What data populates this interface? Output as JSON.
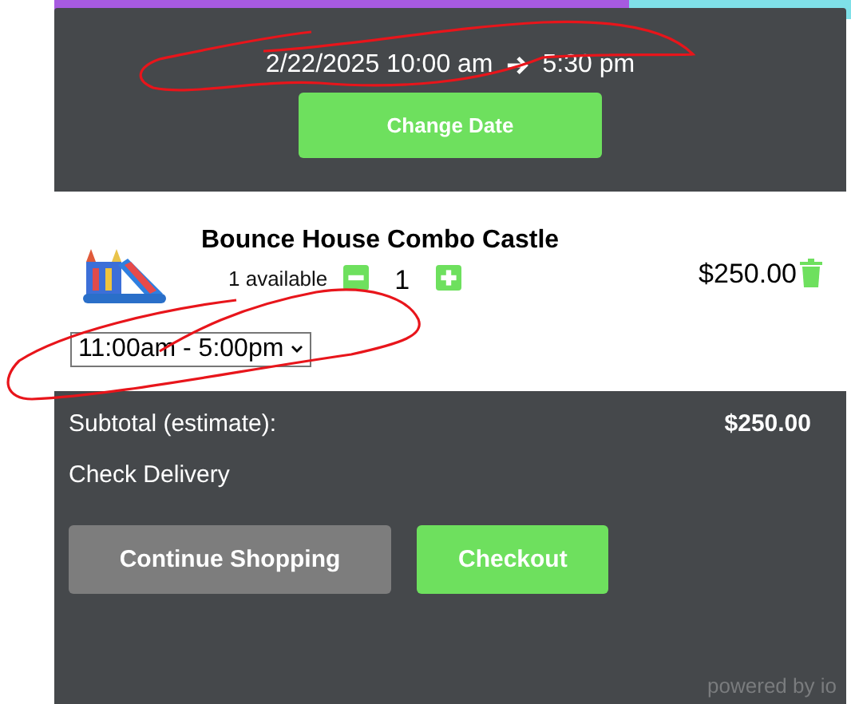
{
  "booking": {
    "start": "2/22/2025 10:00 am",
    "end": "5:30 pm",
    "change_button": "Change Date"
  },
  "cart_item": {
    "kind": "picture",
    "name": "Bounce House Combo Castle",
    "availability": "1 available",
    "quantity": "1",
    "price": "$250.00",
    "time_slot": "11:00am - 5:00pm"
  },
  "summary": {
    "subtotal_label": "Subtotal (estimate):",
    "subtotal": "$250.00",
    "delivery_link": "Check Delivery"
  },
  "buttons": [
    {
      "label": "Continue Shopping",
      "kind": "secondary"
    },
    {
      "label": "Checkout",
      "kind": "primary"
    }
  ],
  "footer": "powered by io"
}
